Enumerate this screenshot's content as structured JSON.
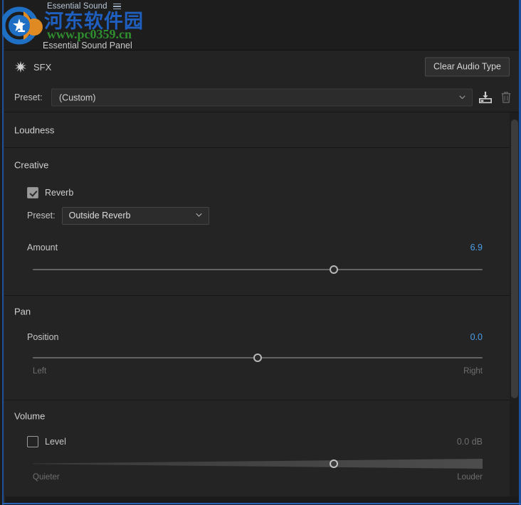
{
  "window": {
    "tab_title": "Essential Sound",
    "tab_menu_icon": "hamburger-menu-icon",
    "panel_title": "Essential Sound Panel"
  },
  "audio_type": {
    "icon": "sfx-starburst-icon",
    "label": "SFX",
    "clear_button_label": "Clear Audio Type"
  },
  "preset": {
    "label": "Preset:",
    "value": "(Custom)",
    "chevron_icon": "chevron-down-icon",
    "save_icon": "save-preset-icon",
    "delete_icon": "trash-delete-icon"
  },
  "sections": {
    "loudness": {
      "title": "Loudness",
      "enabled": true
    },
    "creative": {
      "title": "Creative",
      "enabled": true,
      "reverb": {
        "label": "Reverb",
        "checked": true
      },
      "reverb_preset": {
        "label": "Preset:",
        "value": "Outside Reverb",
        "chevron_icon": "chevron-down-icon"
      },
      "amount": {
        "label": "Amount",
        "value": "6.9",
        "slider_percent": 67
      }
    },
    "pan": {
      "title": "Pan",
      "enabled": true,
      "position": {
        "label": "Position",
        "value": "0.0",
        "slider_percent": 50,
        "end_left": "Left",
        "end_right": "Right"
      }
    },
    "volume": {
      "title": "Volume",
      "level": {
        "label": "Level",
        "checked": false,
        "value": "0.0 dB",
        "slider_percent": 67,
        "end_left": "Quieter",
        "end_right": "Louder"
      }
    }
  },
  "scrollbar": {
    "name": "vertical-scrollbar"
  },
  "watermark": {
    "site_name": "河东软件园",
    "site_url": "www.pc0359.cn"
  },
  "colors": {
    "accent_blue": "#4a9eea",
    "focus_border": "#1c4f9c",
    "panel_bg": "#242424"
  }
}
